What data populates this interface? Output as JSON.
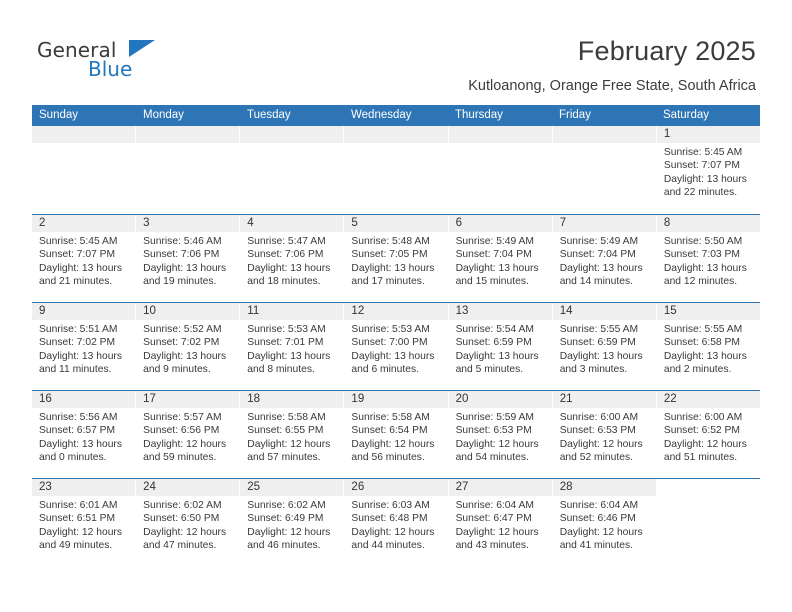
{
  "brand": {
    "name_top": "General",
    "name_bottom": "Blue",
    "accent_color": "#2176bd",
    "triangle_icon": "triangle-logo-icon"
  },
  "header": {
    "title": "February 2025",
    "subtitle": "Kutloanong, Orange Free State, South Africa"
  },
  "calendar": {
    "header_bg": "#2e75b6",
    "daynum_band_bg": "#efefef",
    "row_divider_color": "#2e75b6",
    "weekdays": [
      "Sunday",
      "Monday",
      "Tuesday",
      "Wednesday",
      "Thursday",
      "Friday",
      "Saturday"
    ],
    "labels": {
      "sunrise": "Sunrise:",
      "sunset": "Sunset:",
      "daylight": "Daylight:"
    },
    "weeks": [
      [
        {
          "day": "",
          "empty": true
        },
        {
          "day": "",
          "empty": true
        },
        {
          "day": "",
          "empty": true
        },
        {
          "day": "",
          "empty": true
        },
        {
          "day": "",
          "empty": true
        },
        {
          "day": "",
          "empty": true
        },
        {
          "day": "1",
          "sunrise": "Sunrise: 5:45 AM",
          "sunset": "Sunset: 7:07 PM",
          "daylight_1": "Daylight: 13 hours",
          "daylight_2": "and 22 minutes."
        }
      ],
      [
        {
          "day": "2",
          "sunrise": "Sunrise: 5:45 AM",
          "sunset": "Sunset: 7:07 PM",
          "daylight_1": "Daylight: 13 hours",
          "daylight_2": "and 21 minutes."
        },
        {
          "day": "3",
          "sunrise": "Sunrise: 5:46 AM",
          "sunset": "Sunset: 7:06 PM",
          "daylight_1": "Daylight: 13 hours",
          "daylight_2": "and 19 minutes."
        },
        {
          "day": "4",
          "sunrise": "Sunrise: 5:47 AM",
          "sunset": "Sunset: 7:06 PM",
          "daylight_1": "Daylight: 13 hours",
          "daylight_2": "and 18 minutes."
        },
        {
          "day": "5",
          "sunrise": "Sunrise: 5:48 AM",
          "sunset": "Sunset: 7:05 PM",
          "daylight_1": "Daylight: 13 hours",
          "daylight_2": "and 17 minutes."
        },
        {
          "day": "6",
          "sunrise": "Sunrise: 5:49 AM",
          "sunset": "Sunset: 7:04 PM",
          "daylight_1": "Daylight: 13 hours",
          "daylight_2": "and 15 minutes."
        },
        {
          "day": "7",
          "sunrise": "Sunrise: 5:49 AM",
          "sunset": "Sunset: 7:04 PM",
          "daylight_1": "Daylight: 13 hours",
          "daylight_2": "and 14 minutes."
        },
        {
          "day": "8",
          "sunrise": "Sunrise: 5:50 AM",
          "sunset": "Sunset: 7:03 PM",
          "daylight_1": "Daylight: 13 hours",
          "daylight_2": "and 12 minutes."
        }
      ],
      [
        {
          "day": "9",
          "sunrise": "Sunrise: 5:51 AM",
          "sunset": "Sunset: 7:02 PM",
          "daylight_1": "Daylight: 13 hours",
          "daylight_2": "and 11 minutes."
        },
        {
          "day": "10",
          "sunrise": "Sunrise: 5:52 AM",
          "sunset": "Sunset: 7:02 PM",
          "daylight_1": "Daylight: 13 hours",
          "daylight_2": "and 9 minutes."
        },
        {
          "day": "11",
          "sunrise": "Sunrise: 5:53 AM",
          "sunset": "Sunset: 7:01 PM",
          "daylight_1": "Daylight: 13 hours",
          "daylight_2": "and 8 minutes."
        },
        {
          "day": "12",
          "sunrise": "Sunrise: 5:53 AM",
          "sunset": "Sunset: 7:00 PM",
          "daylight_1": "Daylight: 13 hours",
          "daylight_2": "and 6 minutes."
        },
        {
          "day": "13",
          "sunrise": "Sunrise: 5:54 AM",
          "sunset": "Sunset: 6:59 PM",
          "daylight_1": "Daylight: 13 hours",
          "daylight_2": "and 5 minutes."
        },
        {
          "day": "14",
          "sunrise": "Sunrise: 5:55 AM",
          "sunset": "Sunset: 6:59 PM",
          "daylight_1": "Daylight: 13 hours",
          "daylight_2": "and 3 minutes."
        },
        {
          "day": "15",
          "sunrise": "Sunrise: 5:55 AM",
          "sunset": "Sunset: 6:58 PM",
          "daylight_1": "Daylight: 13 hours",
          "daylight_2": "and 2 minutes."
        }
      ],
      [
        {
          "day": "16",
          "sunrise": "Sunrise: 5:56 AM",
          "sunset": "Sunset: 6:57 PM",
          "daylight_1": "Daylight: 13 hours",
          "daylight_2": "and 0 minutes."
        },
        {
          "day": "17",
          "sunrise": "Sunrise: 5:57 AM",
          "sunset": "Sunset: 6:56 PM",
          "daylight_1": "Daylight: 12 hours",
          "daylight_2": "and 59 minutes."
        },
        {
          "day": "18",
          "sunrise": "Sunrise: 5:58 AM",
          "sunset": "Sunset: 6:55 PM",
          "daylight_1": "Daylight: 12 hours",
          "daylight_2": "and 57 minutes."
        },
        {
          "day": "19",
          "sunrise": "Sunrise: 5:58 AM",
          "sunset": "Sunset: 6:54 PM",
          "daylight_1": "Daylight: 12 hours",
          "daylight_2": "and 56 minutes."
        },
        {
          "day": "20",
          "sunrise": "Sunrise: 5:59 AM",
          "sunset": "Sunset: 6:53 PM",
          "daylight_1": "Daylight: 12 hours",
          "daylight_2": "and 54 minutes."
        },
        {
          "day": "21",
          "sunrise": "Sunrise: 6:00 AM",
          "sunset": "Sunset: 6:53 PM",
          "daylight_1": "Daylight: 12 hours",
          "daylight_2": "and 52 minutes."
        },
        {
          "day": "22",
          "sunrise": "Sunrise: 6:00 AM",
          "sunset": "Sunset: 6:52 PM",
          "daylight_1": "Daylight: 12 hours",
          "daylight_2": "and 51 minutes."
        }
      ],
      [
        {
          "day": "23",
          "sunrise": "Sunrise: 6:01 AM",
          "sunset": "Sunset: 6:51 PM",
          "daylight_1": "Daylight: 12 hours",
          "daylight_2": "and 49 minutes."
        },
        {
          "day": "24",
          "sunrise": "Sunrise: 6:02 AM",
          "sunset": "Sunset: 6:50 PM",
          "daylight_1": "Daylight: 12 hours",
          "daylight_2": "and 47 minutes."
        },
        {
          "day": "25",
          "sunrise": "Sunrise: 6:02 AM",
          "sunset": "Sunset: 6:49 PM",
          "daylight_1": "Daylight: 12 hours",
          "daylight_2": "and 46 minutes."
        },
        {
          "day": "26",
          "sunrise": "Sunrise: 6:03 AM",
          "sunset": "Sunset: 6:48 PM",
          "daylight_1": "Daylight: 12 hours",
          "daylight_2": "and 44 minutes."
        },
        {
          "day": "27",
          "sunrise": "Sunrise: 6:04 AM",
          "sunset": "Sunset: 6:47 PM",
          "daylight_1": "Daylight: 12 hours",
          "daylight_2": "and 43 minutes."
        },
        {
          "day": "28",
          "sunrise": "Sunrise: 6:04 AM",
          "sunset": "Sunset: 6:46 PM",
          "daylight_1": "Daylight: 12 hours",
          "daylight_2": "and 41 minutes."
        },
        {
          "day": "",
          "empty": true
        }
      ]
    ],
    "band_widths": [
      "100%",
      "100%",
      "100%",
      "100%",
      "85.72%"
    ]
  }
}
